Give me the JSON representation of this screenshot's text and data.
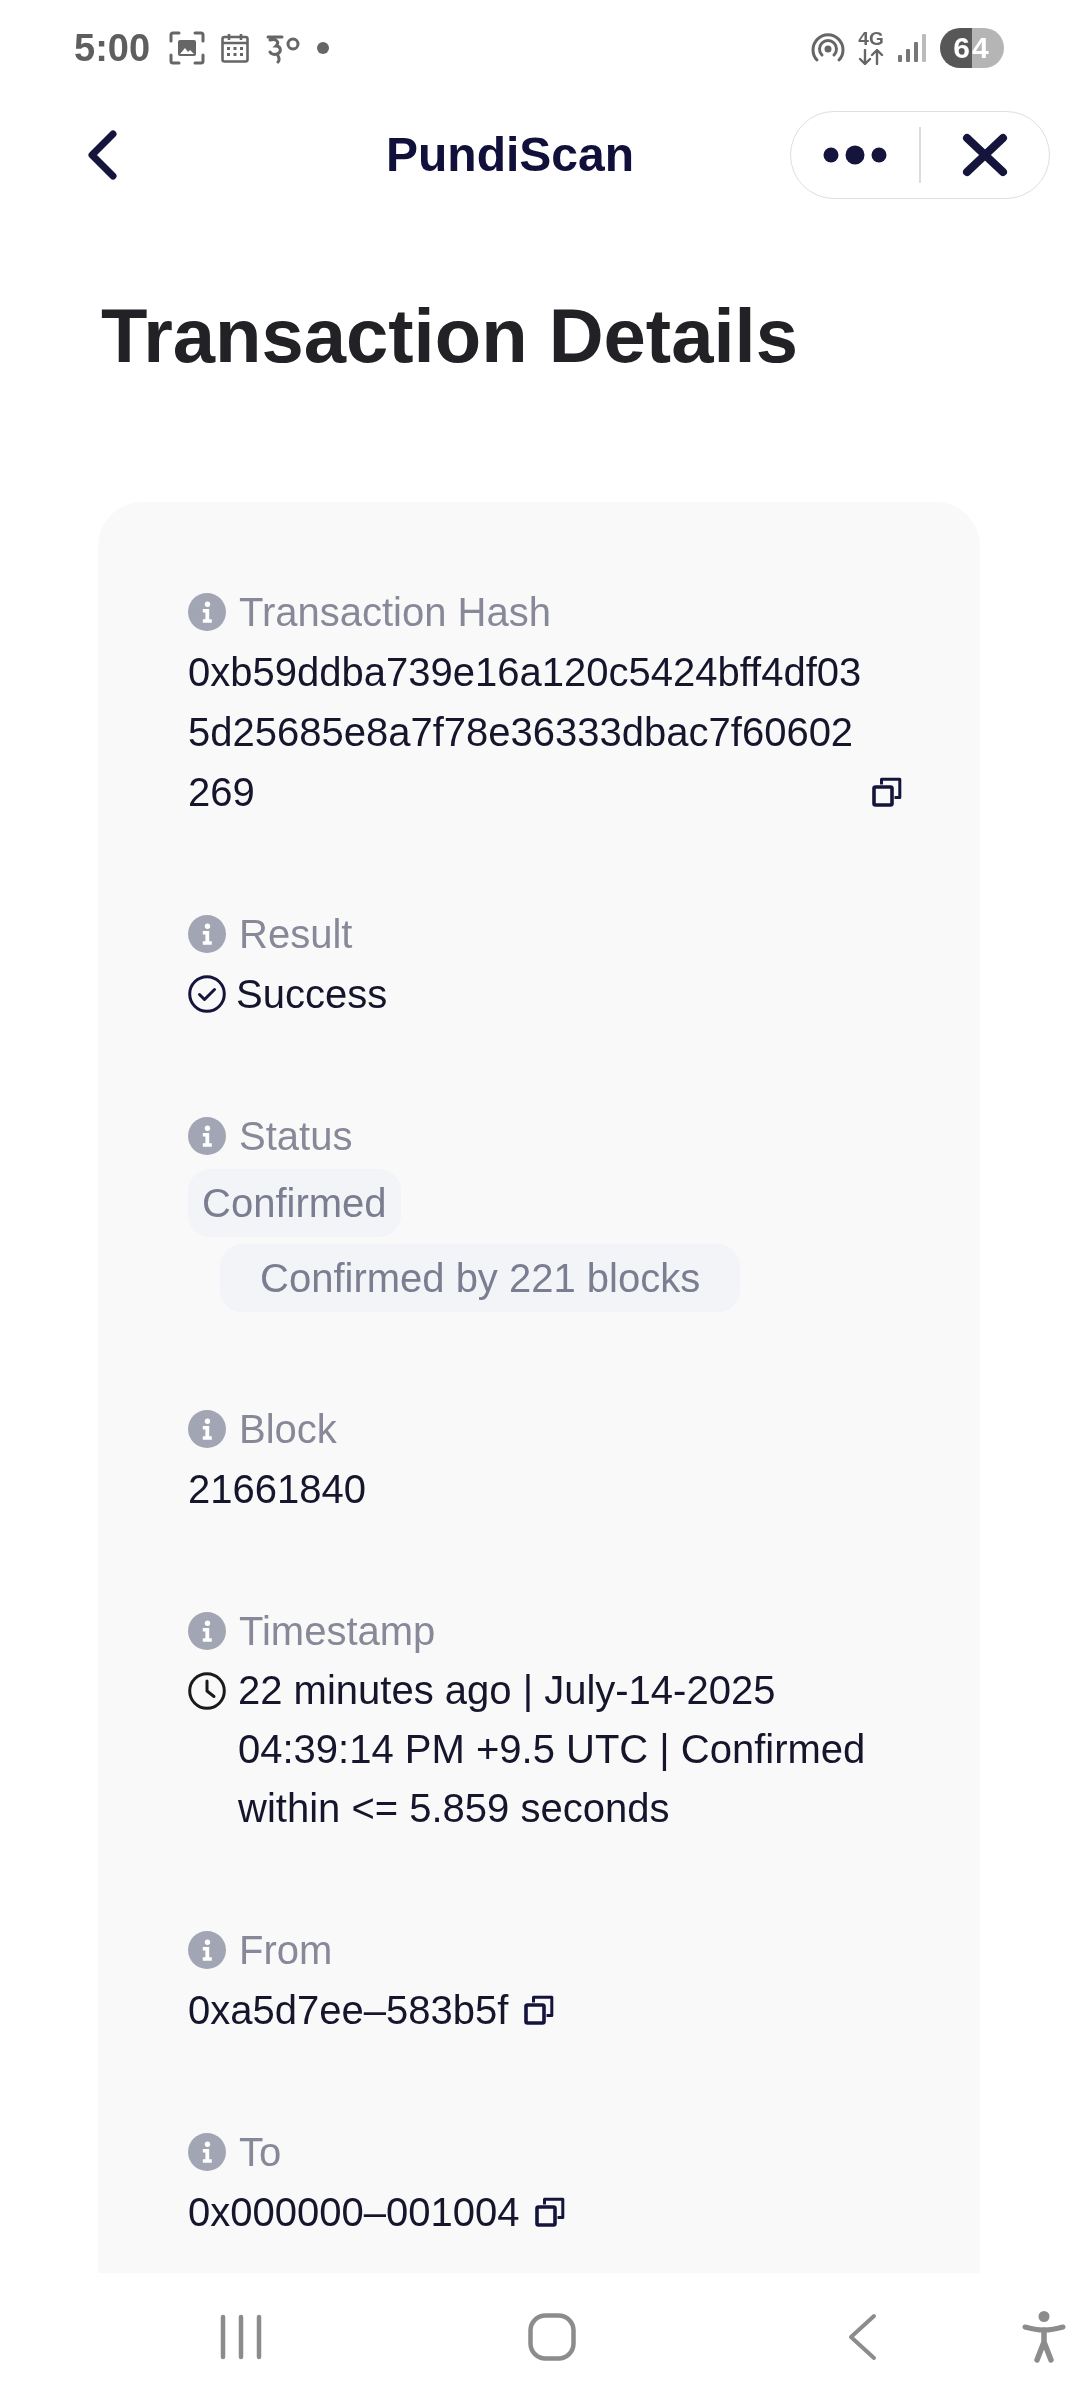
{
  "status_bar": {
    "time": "5:00",
    "network": "4G",
    "battery": "64"
  },
  "header": {
    "title": "PundiScan"
  },
  "page_title": "Transaction Details",
  "fields": [
    {
      "kind": "hash",
      "label": "Transaction Hash",
      "value": "0xb59ddba739e16a120c5424bff4df035d25685e8a7f78e36333dbac7f60602269"
    },
    {
      "kind": "result",
      "label": "Result",
      "value": "Success"
    },
    {
      "kind": "status",
      "label": "Status",
      "value": "Confirmed",
      "detail": "Confirmed by 221 blocks"
    },
    {
      "kind": "text",
      "label": "Block",
      "value": "21661840"
    },
    {
      "kind": "timestamp",
      "label": "Timestamp",
      "value": "22 minutes ago | July-14-2025 04:39:14 PM +9.5 UTC | Confirmed within <= 5.859 seconds"
    },
    {
      "kind": "address",
      "label": "From",
      "value": "0xa5d7ee–583b5f"
    },
    {
      "kind": "address",
      "label": "To",
      "value": "0x000000–001004"
    }
  ]
}
